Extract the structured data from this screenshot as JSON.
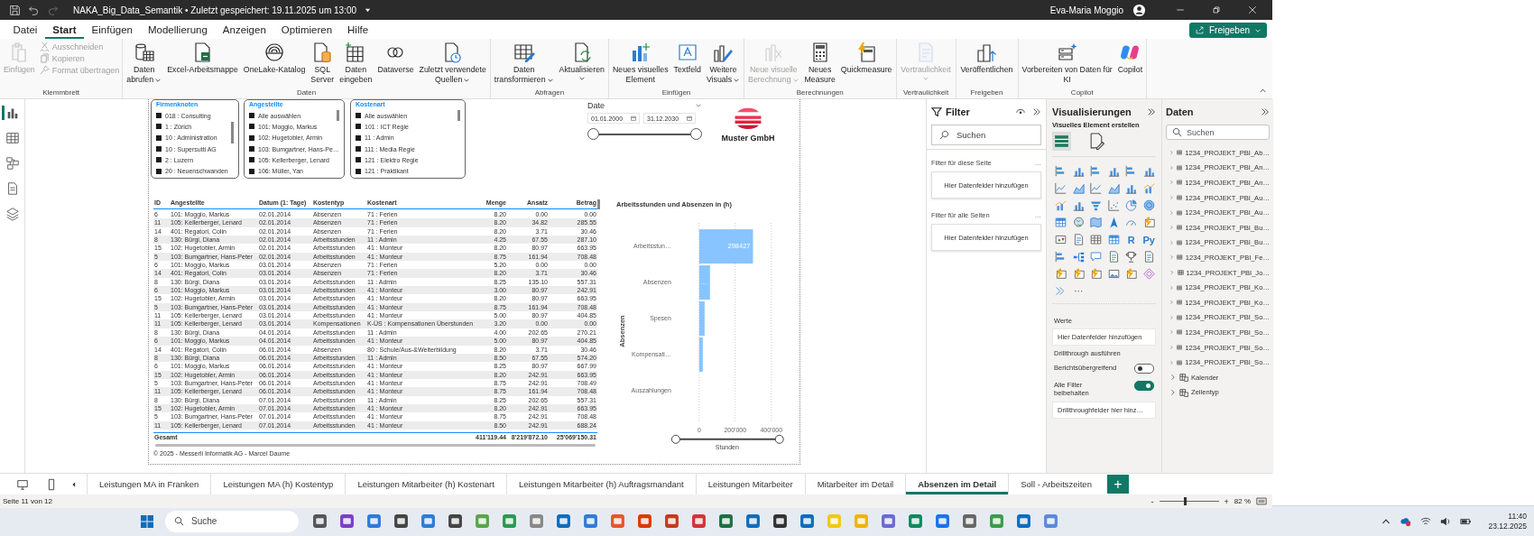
{
  "title_bar": {
    "title": "NAKA_Big_Data_Semantik • Zuletzt gespeichert: 19.11.2025 um 13:00",
    "user": "Eva-Maria Moggio"
  },
  "menu": [
    {
      "label": "Datei",
      "selected": false
    },
    {
      "label": "Start",
      "selected": true
    },
    {
      "label": "Einfügen",
      "selected": false
    },
    {
      "label": "Modellierung",
      "selected": false
    },
    {
      "label": "Anzeigen",
      "selected": false
    },
    {
      "label": "Optimieren",
      "selected": false
    },
    {
      "label": "Hilfe",
      "selected": false
    }
  ],
  "share_button": "Freigeben",
  "ribbon": [
    {
      "label": "Klemmbrett",
      "buttons": [
        {
          "lines": [
            "Einfügen"
          ],
          "disabled": true,
          "dropdown": false
        }
      ],
      "small_buttons": [
        {
          "label": "Ausschneiden",
          "disabled": true
        },
        {
          "label": "Kopieren",
          "disabled": true
        },
        {
          "label": "Format übertragen",
          "disabled": true
        }
      ]
    },
    {
      "label": "Daten",
      "buttons": [
        {
          "lines": [
            "Daten",
            "abrufen"
          ],
          "disabled": false,
          "dropdown": true
        },
        {
          "lines": [
            "Excel-Arbeitsmappe"
          ],
          "disabled": false,
          "dropdown": false
        },
        {
          "lines": [
            "OneLake-Katalog"
          ],
          "disabled": false,
          "dropdown": false
        },
        {
          "lines": [
            "SQL",
            "Server"
          ],
          "disabled": false,
          "dropdown": false
        },
        {
          "lines": [
            "Daten",
            "eingeben"
          ],
          "disabled": false,
          "dropdown": false
        },
        {
          "lines": [
            "Dataverse"
          ],
          "disabled": false,
          "dropdown": false
        },
        {
          "lines": [
            "Zuletzt verwendete",
            "Quellen"
          ],
          "disabled": false,
          "dropdown": true
        }
      ]
    },
    {
      "label": "Abfragen",
      "buttons": [
        {
          "lines": [
            "Daten",
            "transformieren"
          ],
          "disabled": false,
          "dropdown": true
        },
        {
          "lines": [
            "Aktualisieren"
          ],
          "disabled": false,
          "dropdown": true
        }
      ]
    },
    {
      "label": "Einfügen",
      "buttons": [
        {
          "lines": [
            "Neues visuelles",
            "Element"
          ],
          "disabled": false,
          "dropdown": false
        },
        {
          "lines": [
            "Textfeld"
          ],
          "disabled": false,
          "dropdown": false
        },
        {
          "lines": [
            "Weitere",
            "Visuals"
          ],
          "disabled": false,
          "dropdown": true
        }
      ]
    },
    {
      "label": "Berechnungen",
      "buttons": [
        {
          "lines": [
            "Neue visuelle",
            "Berechnung"
          ],
          "disabled": true,
          "dropdown": true
        },
        {
          "lines": [
            "Neues",
            "Measure"
          ],
          "disabled": false,
          "dropdown": false
        },
        {
          "lines": [
            "Quickmeasure"
          ],
          "disabled": false,
          "dropdown": false
        }
      ]
    },
    {
      "label": "Vertraulichkeit",
      "buttons": [
        {
          "lines": [
            "Vertraulichkeit"
          ],
          "disabled": true,
          "dropdown": true
        }
      ]
    },
    {
      "label": "Freigeben",
      "buttons": [
        {
          "lines": [
            "Veröffentlichen"
          ],
          "disabled": false,
          "dropdown": false
        }
      ]
    },
    {
      "label": "Copilot",
      "buttons": [
        {
          "lines": [
            "Vorbereiten von Daten für",
            "KI"
          ],
          "disabled": false,
          "dropdown": false
        },
        {
          "lines": [
            "Copilot"
          ],
          "disabled": false,
          "dropdown": false
        }
      ]
    }
  ],
  "view_rail": [
    {
      "selected": true
    },
    {
      "selected": false
    },
    {
      "selected": false
    },
    {
      "selected": false
    },
    {
      "selected": false
    }
  ],
  "report": {
    "slicers": [
      {
        "title": "Firmenknoten",
        "items": [
          {
            "label": "018 : Consulting",
            "checked": false
          },
          {
            "label": "1 : Zürich",
            "checked": false
          },
          {
            "label": "10 : Administration",
            "checked": false
          },
          {
            "label": "10 : Supersutti AG",
            "checked": false
          },
          {
            "label": "2 : Luzern",
            "checked": false
          },
          {
            "label": "20 : Neuenschwanden",
            "checked": false
          }
        ]
      },
      {
        "title": "Angestellte",
        "items": [
          {
            "label": "Alle auswählen",
            "checked": false
          },
          {
            "label": "101: Moggio, Markus",
            "checked": false
          },
          {
            "label": "102: Hugetobler, Armin",
            "checked": false
          },
          {
            "label": "103: Bumgartner, Hans-Pe…",
            "checked": false
          },
          {
            "label": "105: Kellerberger, Lenard",
            "checked": false
          },
          {
            "label": "106: Müller, Yan",
            "checked": false
          }
        ]
      },
      {
        "title": "Kostenart",
        "items": [
          {
            "label": "Alle auswählen",
            "checked": false
          },
          {
            "label": "101 : ICT Regie",
            "checked": false
          },
          {
            "label": "11 : Admin",
            "checked": false
          },
          {
            "label": "111 : Media Regie",
            "checked": false
          },
          {
            "label": "121 : Elektro Regie",
            "checked": false
          },
          {
            "label": "121 : Praktikant",
            "checked": false
          }
        ]
      }
    ],
    "date_slicer": {
      "title": "Date",
      "from": "01.01.2000",
      "to": "31.12.2030",
      "slider": {
        "level": 1
      }
    },
    "logo_text": "Muster GmbH",
    "table": {
      "columns": [
        "ID",
        "Angestellte",
        "Datum (1: Tage)",
        "Kostentyp",
        "Kostenart",
        "Menge",
        "Ansatz",
        "Betrag"
      ],
      "rows": [
        [
          "6",
          "101: Moggio, Markus",
          "02.01.2014",
          "Absenzen",
          "71 : Ferien",
          "8.20",
          "0.00",
          "0.00"
        ],
        [
          "11",
          "105: Kellerberger, Lenard",
          "02.01.2014",
          "Absenzen",
          "71 : Ferien",
          "8.20",
          "34.82",
          "285.55"
        ],
        [
          "14",
          "401: Regatori, Colin",
          "02.01.2014",
          "Absenzen",
          "71 : Ferien",
          "8.20",
          "3.71",
          "30.46"
        ],
        [
          "8",
          "130: Bürgi, Diana",
          "02.01.2014",
          "Arbeitsstunden",
          "11 : Admin",
          "4.25",
          "67.55",
          "287.10"
        ],
        [
          "15",
          "102: Hugetobler, Armin",
          "02.01.2014",
          "Arbeitsstunden",
          "41 : Monteur",
          "8.20",
          "80.97",
          "663.95"
        ],
        [
          "5",
          "103: Bumgartner, Hans-Peter",
          "02.01.2014",
          "Arbeitsstunden",
          "41 : Monteur",
          "8.75",
          "161.94",
          "708.48"
        ],
        [
          "6",
          "101: Moggio, Markus",
          "03.01.2014",
          "Absenzen",
          "71 : Ferien",
          "5.20",
          "0.00",
          "0.00"
        ],
        [
          "14",
          "401: Regatori, Colin",
          "03.01.2014",
          "Absenzen",
          "71 : Ferien",
          "8.20",
          "3.71",
          "30.46"
        ],
        [
          "8",
          "130: Bürgi, Diana",
          "03.01.2014",
          "Arbeitsstunden",
          "11 : Admin",
          "8.25",
          "135.10",
          "557.31"
        ],
        [
          "6",
          "101: Moggio, Markus",
          "03.01.2014",
          "Arbeitsstunden",
          "41 : Monteur",
          "3.00",
          "80.97",
          "242.91"
        ],
        [
          "15",
          "102: Hugetobler, Armin",
          "03.01.2014",
          "Arbeitsstunden",
          "41 : Monteur",
          "8.20",
          "80.97",
          "663.95"
        ],
        [
          "5",
          "103: Bumgartner, Hans-Peter",
          "03.01.2014",
          "Arbeitsstunden",
          "41 : Monteur",
          "8.75",
          "161.94",
          "708.48"
        ],
        [
          "11",
          "105: Kellerberger, Lenard",
          "03.01.2014",
          "Arbeitsstunden",
          "41 : Monteur",
          "5.00",
          "80.97",
          "404.85"
        ],
        [
          "11",
          "105: Kellerberger, Lenard",
          "03.01.2014",
          "Kompensationen",
          "K-ÜS : Kompensationen Überstunden",
          "3.20",
          "0.00",
          "0.00"
        ],
        [
          "8",
          "130: Bürgi, Diana",
          "04.01.2014",
          "Arbeitsstunden",
          "11 : Admin",
          "4.00",
          "202.65",
          "270.21"
        ],
        [
          "6",
          "101: Moggio, Markus",
          "04.01.2014",
          "Arbeitsstunden",
          "41 : Monteur",
          "5.00",
          "80.97",
          "404.85"
        ],
        [
          "14",
          "401: Regatori, Colin",
          "06.01.2014",
          "Absenzen",
          "80 : Schule/Aus-&Weiterbildung",
          "8.20",
          "3.71",
          "30.46"
        ],
        [
          "8",
          "130: Bürgi, Diana",
          "06.01.2014",
          "Arbeitsstunden",
          "11 : Admin",
          "8.50",
          "67.55",
          "574.20"
        ],
        [
          "6",
          "101: Moggio, Markus",
          "06.01.2014",
          "Arbeitsstunden",
          "41 : Monteur",
          "8.25",
          "80.97",
          "667.99"
        ],
        [
          "15",
          "102: Hugetobler, Armin",
          "06.01.2014",
          "Arbeitsstunden",
          "41 : Monteur",
          "8.20",
          "242.91",
          "663.95"
        ],
        [
          "5",
          "103: Bumgartner, Hans-Peter",
          "06.01.2014",
          "Arbeitsstunden",
          "41 : Monteur",
          "8.75",
          "242.91",
          "708.49"
        ],
        [
          "11",
          "105: Kellerberger, Lenard",
          "06.01.2014",
          "Arbeitsstunden",
          "41 : Monteur",
          "8.75",
          "161.94",
          "708.48"
        ],
        [
          "8",
          "130: Bürgi, Diana",
          "07.01.2014",
          "Arbeitsstunden",
          "11 : Admin",
          "8.25",
          "202.65",
          "557.31"
        ],
        [
          "15",
          "102: Hugetobler, Armin",
          "07.01.2014",
          "Arbeitsstunden",
          "41 : Monteur",
          "8.20",
          "242.91",
          "663.95"
        ],
        [
          "5",
          "103: Bumgartner, Hans-Peter",
          "07.01.2014",
          "Arbeitsstunden",
          "41 : Monteur",
          "8.75",
          "242.91",
          "708.48"
        ],
        [
          "11",
          "105: Kellerberger, Lenard",
          "07.01.2014",
          "Arbeitsstunden",
          "41 : Monteur",
          "8.50",
          "242.91",
          "688.24"
        ]
      ],
      "total": {
        "label": "Gesamt",
        "values": [
          "411'119.44",
          "8'219'872.10",
          "25'069'150.31"
        ]
      }
    },
    "chart": {
      "chart_data": {
        "type": "bar",
        "orientation": "horizontal",
        "title": "Arbeitsstunden und Absenzen in (h)",
        "ylabel": "Absenzen",
        "xlabel": "Stunden",
        "categories": [
          "Arbeitsstun…",
          "Absenzen",
          "Spesen",
          "Kompensati…",
          "Auszahlungen"
        ],
        "values": [
          298427,
          60000,
          30000,
          20000,
          null
        ],
        "xlim": [
          0,
          400000
        ],
        "xticks": [
          {
            "value": 0,
            "label": "0"
          },
          {
            "value": 200000,
            "label": "200'000"
          },
          {
            "value": 400000,
            "label": "400'000"
          }
        ],
        "value_labels": [
          "298427",
          "…",
          null,
          null,
          null
        ]
      }
    },
    "footer": "© 2025 - Messerli Informatik AG - Marcel Daume"
  },
  "filter_pane": {
    "title": "Filter",
    "search_placeholder": "Suchen",
    "sections": [
      {
        "title": "Filter für diese Seite",
        "more": "…",
        "drop_label": "Hier Datenfelder hinzufügen"
      },
      {
        "title": "Filter für alle Seiten",
        "more": "…",
        "drop_label": "Hier Datenfelder hinzufügen"
      }
    ]
  },
  "visualizations": {
    "title": "Visualisierungen",
    "subtitle": "Visuelles Element erstellen",
    "build_tabs": [
      {
        "selected": true
      },
      {
        "selected": false
      }
    ],
    "script_labels": [
      "R",
      "Py"
    ],
    "more_label": "···",
    "values_label": "Werte",
    "values_drop": "Hier Datenfelder hinzufügen",
    "drillthrough_title": "Drillthrough ausführen",
    "toggles": [
      {
        "label": "Berichtsübergreifend",
        "on": false
      },
      {
        "label": "Alle Filter beibehalten",
        "on": true
      }
    ],
    "drillthrough_drop": "Drillthroughfelder hier hinz…"
  },
  "data_pane": {
    "title": "Daten",
    "search_placeholder": "Suchen",
    "items": [
      {
        "kind": "table",
        "label": "1234_PROJEKT_PBI_Ab…"
      },
      {
        "kind": "table",
        "label": "1234_PROJEKT_PBI_An…"
      },
      {
        "kind": "table",
        "label": "1234_PROJEKT_PBI_An…"
      },
      {
        "kind": "table",
        "label": "1234_PROJEKT_PBI_Au…"
      },
      {
        "kind": "table",
        "label": "1234_PROJEKT_PBI_Au…"
      },
      {
        "kind": "table",
        "label": "1234_PROJEKT_PBI_Bu…"
      },
      {
        "kind": "table",
        "label": "1234_PROJEKT_PBI_Bu…"
      },
      {
        "kind": "table",
        "label": "1234_PROJEKT_PBI_Fe…"
      },
      {
        "kind": "table",
        "label": "1234_PROJEKT_PBI_Jo…"
      },
      {
        "kind": "table",
        "label": "1234_PROJEKT_PBI_Ko…"
      },
      {
        "kind": "table",
        "label": "1234_PROJEKT_PBI_Ko…"
      },
      {
        "kind": "table",
        "label": "1234_PROJEKT_PBI_So…"
      },
      {
        "kind": "table",
        "label": "1234_PROJEKT_PBI_So…"
      },
      {
        "kind": "table",
        "label": "1234_PROJEKT_PBI_So…"
      },
      {
        "kind": "table",
        "label": "1234_PROJEKT_PBI_So…"
      },
      {
        "kind": "calc_table",
        "label": "Kalender"
      },
      {
        "kind": "calc_table",
        "label": "Zeilentyp"
      }
    ]
  },
  "page_tabs": [
    {
      "label": "Leistungen MA in Franken",
      "selected": false
    },
    {
      "label": "Leistungen MA (h) Kostentyp",
      "selected": false
    },
    {
      "label": "Leistungen Mitarbeiter (h) Kostenart",
      "selected": false
    },
    {
      "label": "Leistungen Mitarbeiter (h) Auftragsmandant",
      "selected": false
    },
    {
      "label": "Leistungen Mitarbeiter",
      "selected": false
    },
    {
      "label": "Mitarbeiter im Detail",
      "selected": false
    },
    {
      "label": "Absenzen im Detail",
      "selected": true
    },
    {
      "label": "Soll - Arbeitszeiten",
      "selected": false
    }
  ],
  "add_page": "+",
  "status_bar": {
    "page": "Seite 11 von 12",
    "zoom_out": "-",
    "zoom_in": "+",
    "zoom": "82 %",
    "zoom_slider": {
      "level": 0.43
    }
  },
  "taskbar": {
    "search_placeholder": "Suche",
    "time": "11:40",
    "date": "23.12.2025"
  }
}
